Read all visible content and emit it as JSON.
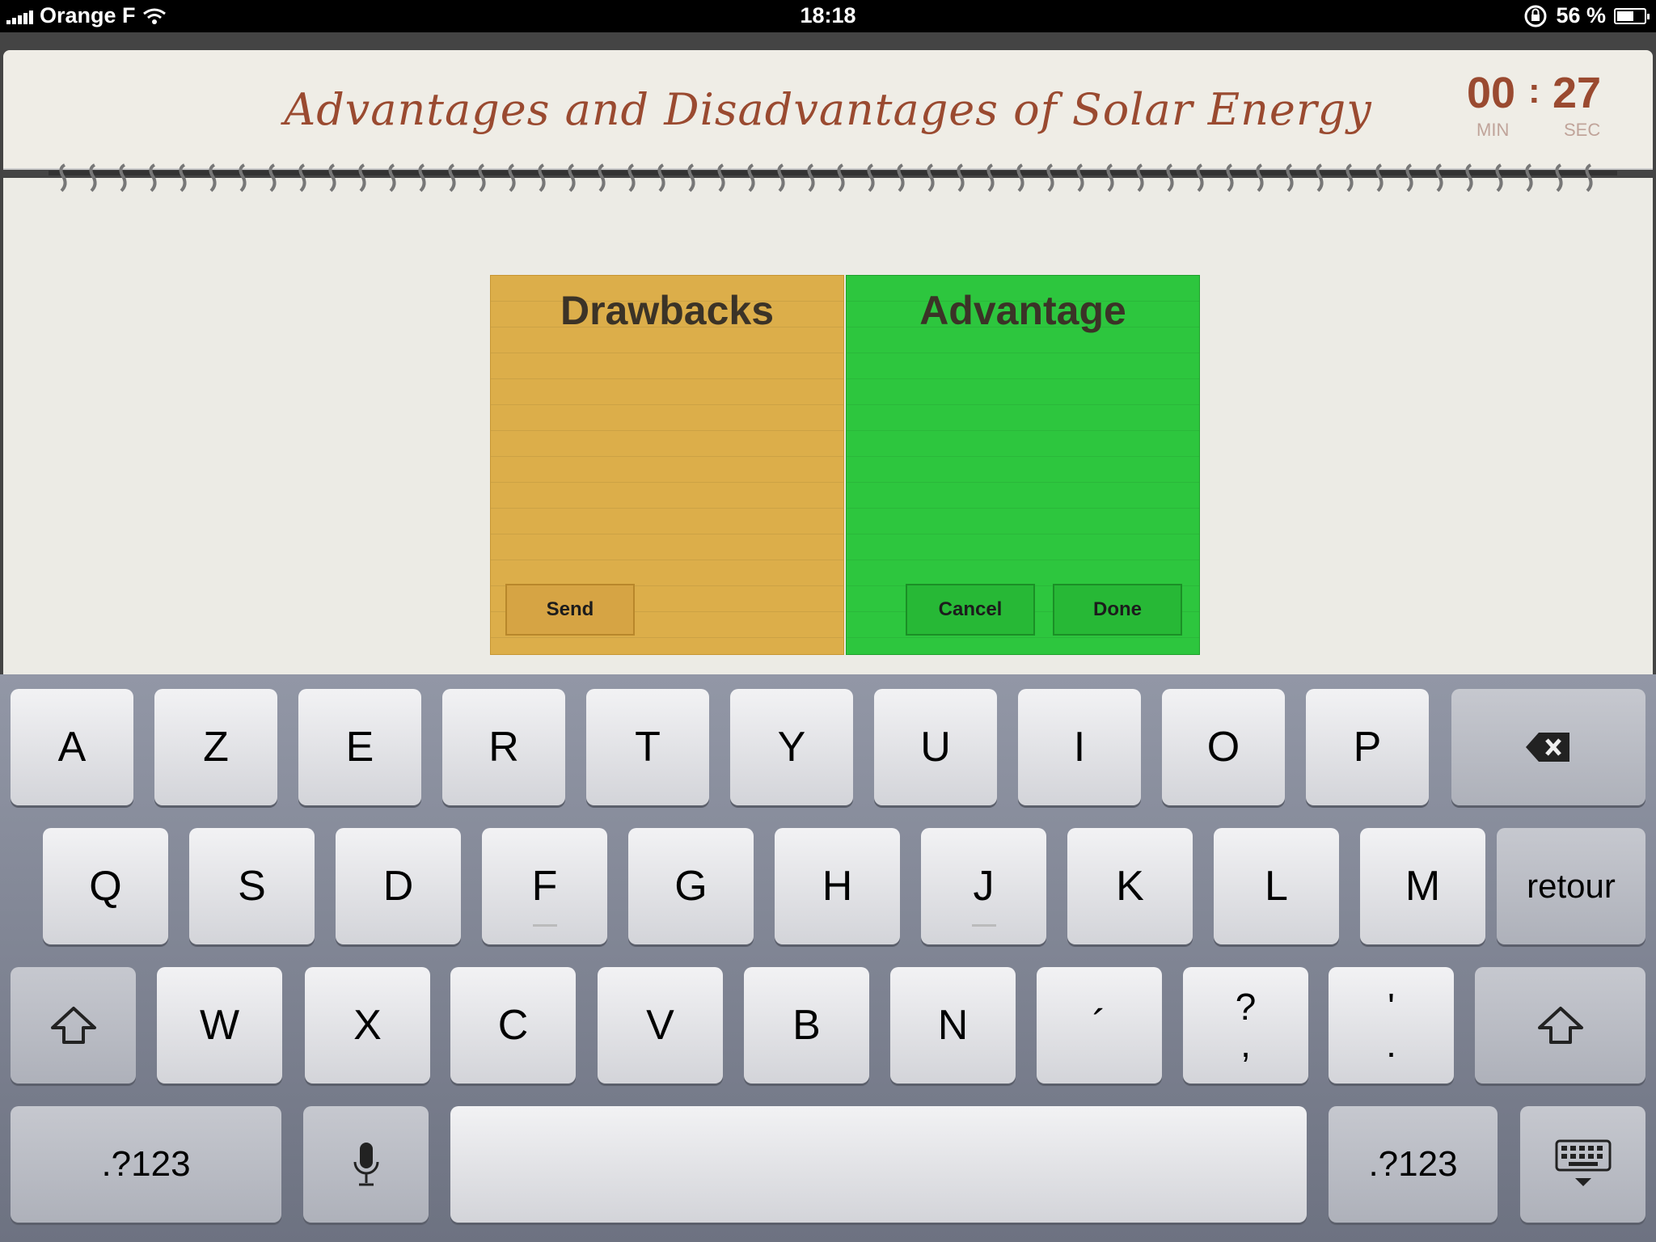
{
  "status_bar": {
    "carrier": "Orange F",
    "time": "18:18",
    "battery": "56 %",
    "battery_level": 0.56
  },
  "header": {
    "title": "Advantages and Disadvantages of Solar Energy",
    "timer": {
      "minutes": "00",
      "separator": ":",
      "seconds": "27",
      "min_label": "MIN",
      "sec_label": "SEC"
    }
  },
  "cards": {
    "drawbacks": {
      "title": "Drawbacks",
      "color": "#dcae4a",
      "send_label": "Send"
    },
    "advantage": {
      "title": "Advantage",
      "color": "#2dc63e",
      "cancel_label": "Cancel",
      "done_label": "Done"
    }
  },
  "keyboard": {
    "row1": [
      "A",
      "Z",
      "E",
      "R",
      "T",
      "Y",
      "U",
      "I",
      "O",
      "P"
    ],
    "row2": [
      "Q",
      "S",
      "D",
      "F",
      "G",
      "H",
      "J",
      "K",
      "L",
      "M"
    ],
    "return_label": "retour",
    "row3": [
      "W",
      "X",
      "C",
      "V",
      "B",
      "N"
    ],
    "apostrophe": "´",
    "question_top": "?",
    "question_bottom": ",",
    "quote_top": "'",
    "quote_bottom": ".",
    "numbers_label": ".?123"
  }
}
